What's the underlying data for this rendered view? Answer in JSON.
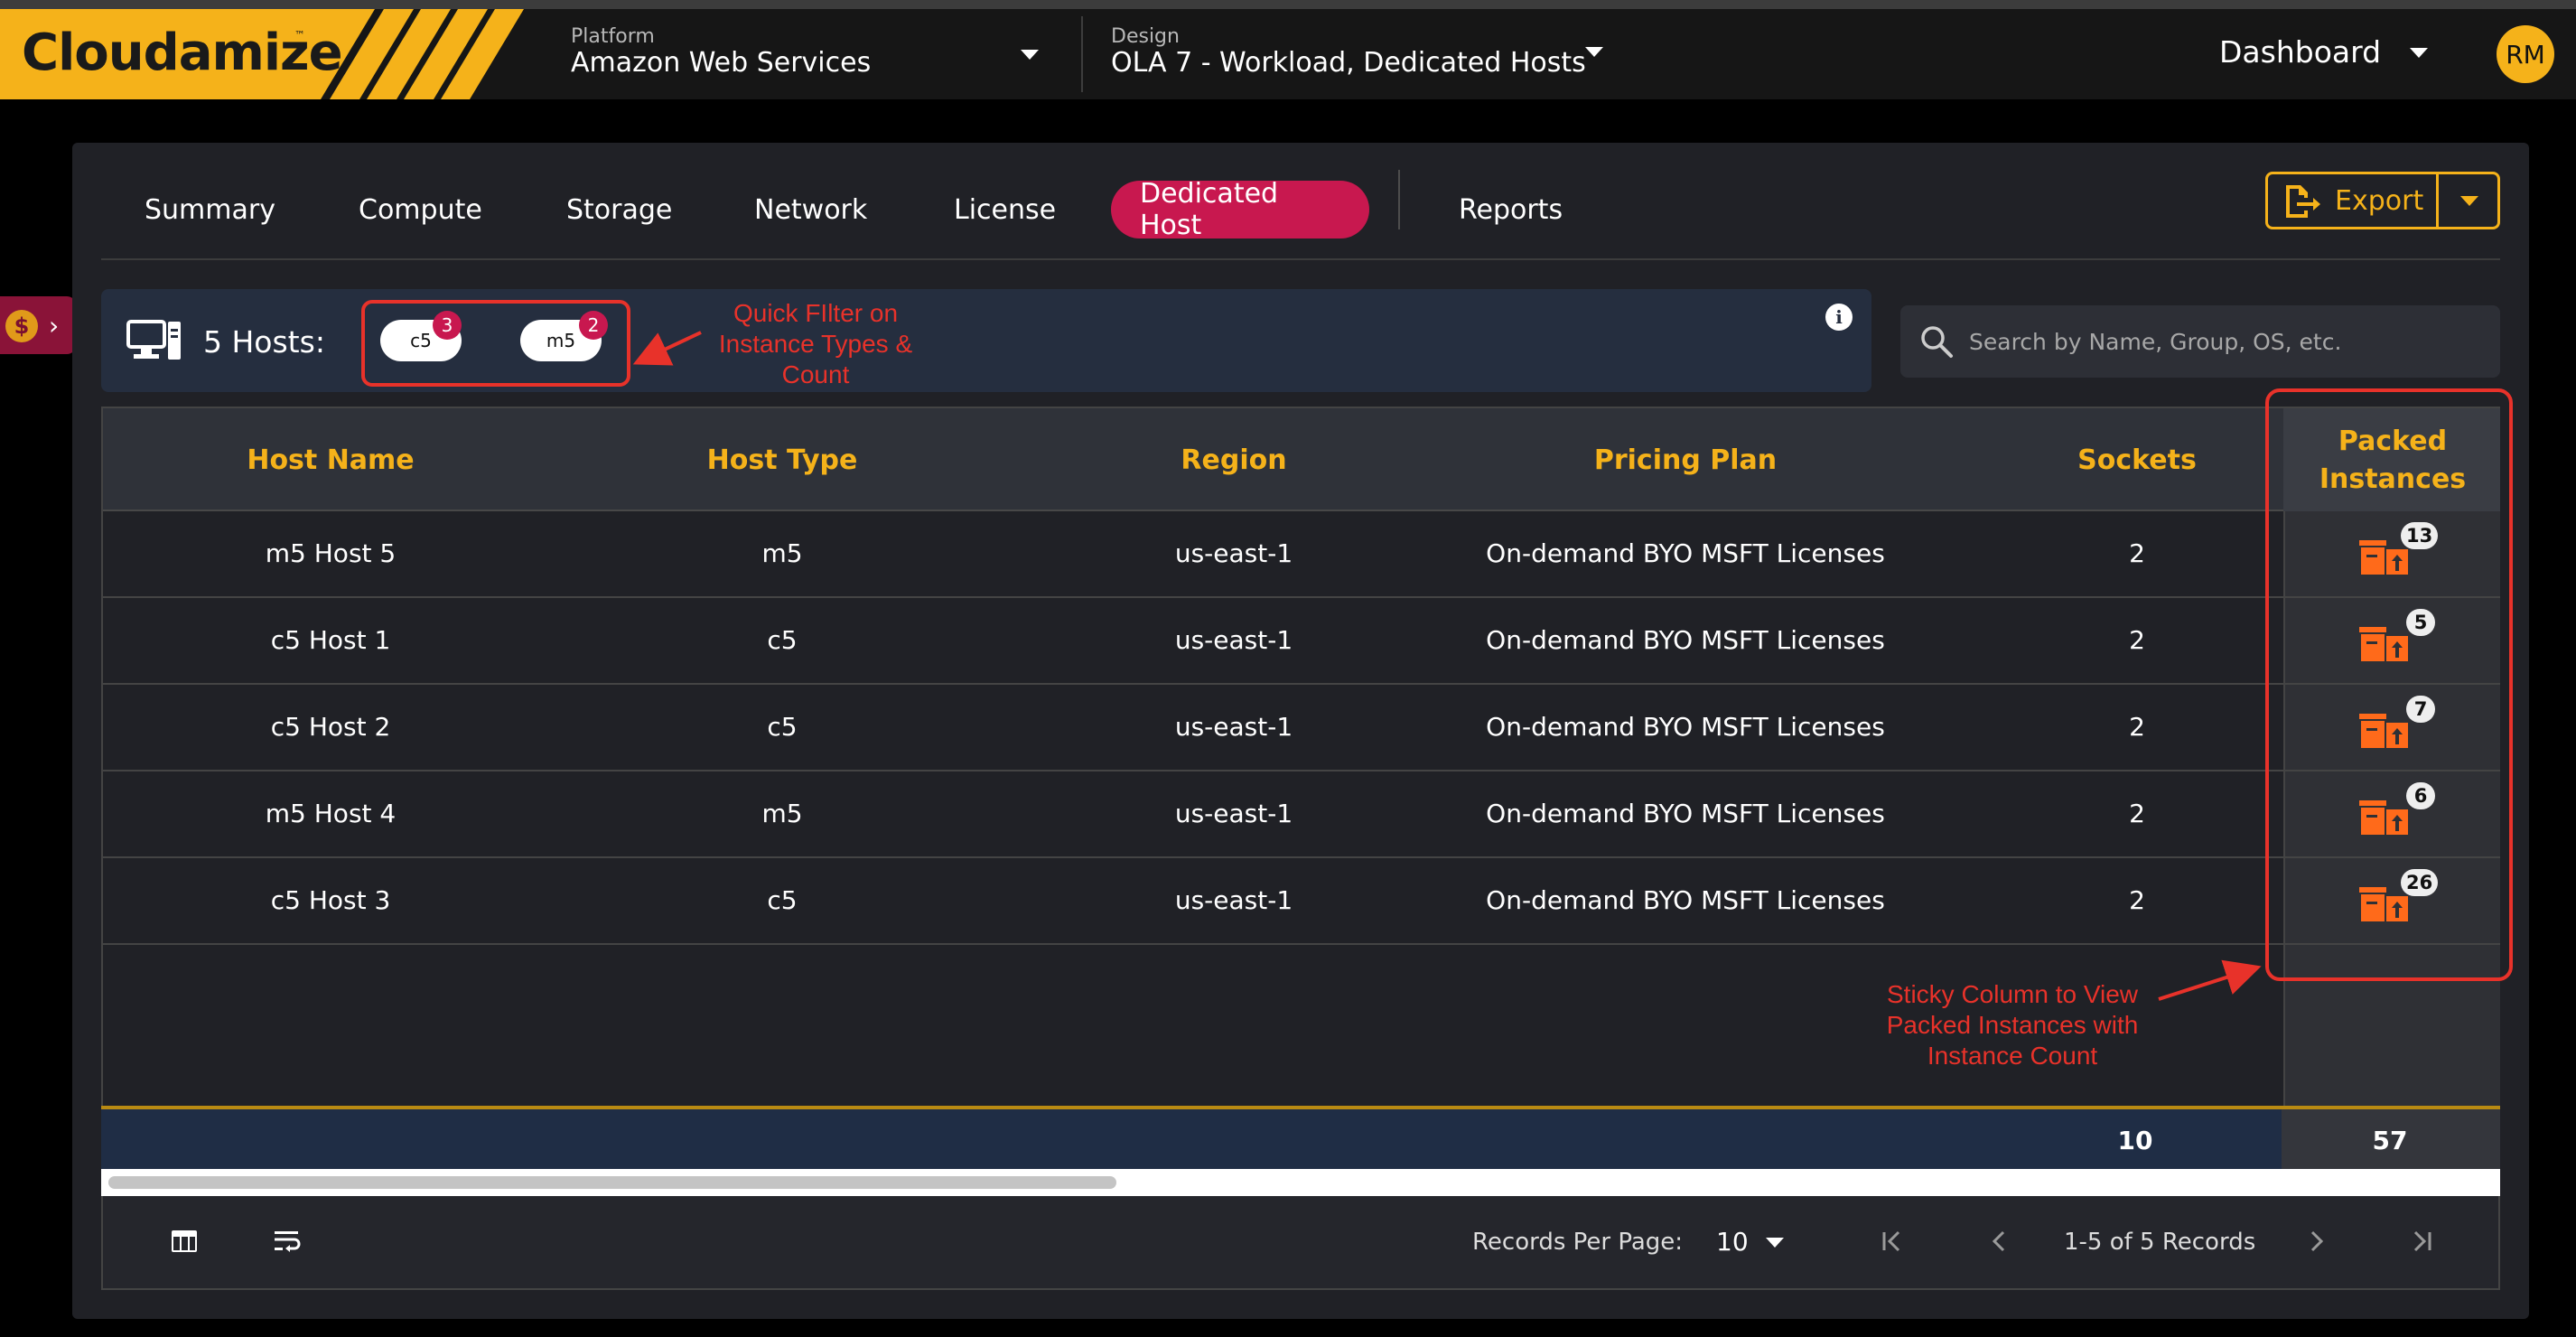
{
  "header": {
    "logo_text": "Cloudamize",
    "logo_tm": "™",
    "platform_label": "Platform",
    "platform_value": "Amazon Web Services",
    "design_label": "Design",
    "design_value": "OLA 7 - Workload, Dedicated Hosts",
    "view_label": "Dashboard",
    "user_initials": "RM"
  },
  "side_tab": {
    "icon": "dollar-coin-icon",
    "symbol": "$",
    "chevron": "›"
  },
  "tabs": [
    {
      "label": "Summary"
    },
    {
      "label": "Compute"
    },
    {
      "label": "Storage"
    },
    {
      "label": "Network"
    },
    {
      "label": "License"
    },
    {
      "label": "Dedicated Host",
      "active": true
    },
    {
      "label": "Reports"
    }
  ],
  "export": {
    "label": "Export"
  },
  "filter": {
    "hosts_label": "5 Hosts:",
    "chips": [
      {
        "label": "c5",
        "count": "3"
      },
      {
        "label": "m5",
        "count": "2"
      }
    ],
    "info_symbol": "i"
  },
  "search": {
    "placeholder": "Search by Name, Group, OS, etc."
  },
  "table": {
    "columns": [
      "Host Name",
      "Host Type",
      "Region",
      "Pricing Plan",
      "Sockets"
    ],
    "packed_header_line1": "Packed",
    "packed_header_line2": "Instances",
    "rows": [
      {
        "host_name": "m5 Host 5",
        "host_type": "m5",
        "region": "us-east-1",
        "pricing_plan": "On-demand BYO MSFT Licenses",
        "sockets": "2",
        "packed": "13"
      },
      {
        "host_name": "c5 Host 1",
        "host_type": "c5",
        "region": "us-east-1",
        "pricing_plan": "On-demand BYO MSFT Licenses",
        "sockets": "2",
        "packed": "5"
      },
      {
        "host_name": "c5 Host 2",
        "host_type": "c5",
        "region": "us-east-1",
        "pricing_plan": "On-demand BYO MSFT Licenses",
        "sockets": "2",
        "packed": "7"
      },
      {
        "host_name": "m5 Host 4",
        "host_type": "m5",
        "region": "us-east-1",
        "pricing_plan": "On-demand BYO MSFT Licenses",
        "sockets": "2",
        "packed": "6"
      },
      {
        "host_name": "c5 Host 3",
        "host_type": "c5",
        "region": "us-east-1",
        "pricing_plan": "On-demand BYO MSFT Licenses",
        "sockets": "2",
        "packed": "26"
      }
    ],
    "totals": {
      "sockets": "10",
      "packed": "57"
    }
  },
  "pagination": {
    "records_per_page_label": "Records Per Page:",
    "records_per_page_value": "10",
    "page_info": "1-5 of 5 Records"
  },
  "annotations": {
    "quick_filter_line1": "Quick FIlter on",
    "quick_filter_line2": "Instance Types &",
    "quick_filter_line3": "Count",
    "sticky_line1": "Sticky Column to View",
    "sticky_line2": "Packed Instances with",
    "sticky_line3": "Instance Count",
    "color": "#e8322a"
  },
  "colors": {
    "accent": "#f5b21a",
    "active_tab": "#c8184f",
    "background": "#202126"
  }
}
